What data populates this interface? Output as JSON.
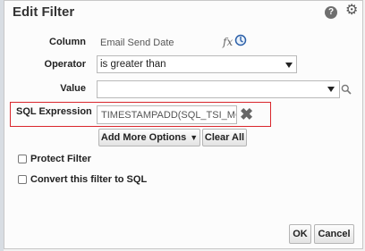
{
  "dialog": {
    "title": "Edit Filter",
    "icons": {
      "help": "help-icon",
      "close": "close-icon"
    }
  },
  "form": {
    "column": {
      "label": "Column",
      "value": "Email Send Date",
      "icons": [
        "fx-icon",
        "column-picker-icon"
      ]
    },
    "operator": {
      "label": "Operator",
      "selected": "is greater than"
    },
    "value": {
      "label": "Value",
      "value": "",
      "icons": [
        "dropdown-arrow-icon",
        "search-icon"
      ]
    },
    "sql_expression": {
      "label": "SQL Expression",
      "value": "TIMESTAMPADD(SQL_TSI_MC",
      "clear_icon": "clear-x-icon"
    }
  },
  "buttons": {
    "add_more_options": "Add More Options",
    "clear_all": "Clear All",
    "ok": "OK",
    "cancel": "Cancel"
  },
  "checkboxes": {
    "protect_filter": {
      "label": "Protect Filter",
      "checked": false
    },
    "convert_to_sql": {
      "label": "Convert this filter to SQL",
      "checked": false
    }
  },
  "colors": {
    "highlight": "#d9262c"
  }
}
